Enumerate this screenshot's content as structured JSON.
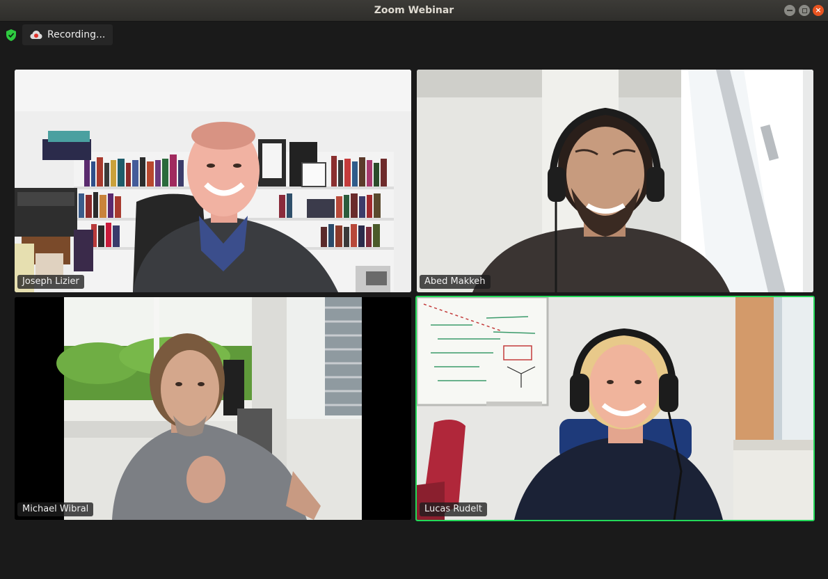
{
  "window": {
    "title": "Zoom Webinar",
    "controls": [
      "minimize-icon",
      "maximize-icon",
      "close-icon"
    ]
  },
  "status_bar": {
    "security_icon": "shield-check-icon",
    "recording_icon": "cloud-record-icon",
    "recording_label": "Recording..."
  },
  "participants": [
    {
      "name": "Joseph Lizier",
      "active_speaker": false
    },
    {
      "name": "Abed Makkeh",
      "active_speaker": false
    },
    {
      "name": "Michael Wibral",
      "active_speaker": false
    },
    {
      "name": "Lucas Rudelt",
      "active_speaker": true
    }
  ],
  "colors": {
    "active_speaker_border": "#23d959",
    "security_shield": "#2ecc40",
    "close_button": "#e95420"
  }
}
